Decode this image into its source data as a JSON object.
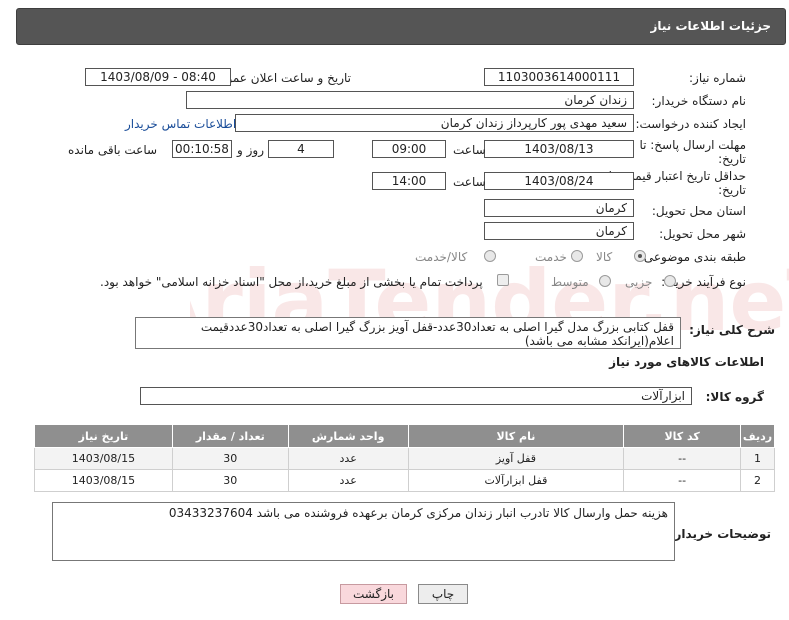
{
  "header": {
    "title": "جزئیات اطلاعات نیاز"
  },
  "labels": {
    "need_number": "شماره نیاز:",
    "announce_datetime": "تاریخ و ساعت اعلان عمومی:",
    "buyer_org": "نام دستگاه خریدار:",
    "requester": "ایجاد کننده درخواست:",
    "reply_deadline_1": "مهلت ارسال پاسخ: تا",
    "reply_deadline_2": "تاریخ:",
    "time": "ساعت",
    "day_and": "روز و",
    "time_remaining": "ساعت باقی مانده",
    "price_validity_1": "حداقل تاریخ اعتبار قیمت: تا",
    "price_validity_2": "تاریخ:",
    "delivery_province": "استان محل تحویل:",
    "delivery_city": "شهر محل تحویل:",
    "category": "طبقه بندی موضوعی:",
    "purchase_type": "نوع فرآیند خرید :",
    "need_desc": "شرح کلی نیاز:",
    "goods_info": "اطلاعات کالاهای مورد نیاز",
    "goods_group": "گروه کالا:",
    "buyer_notes": "توضیحات خریدار:"
  },
  "fields": {
    "need_number": "1103003614000111",
    "announce_datetime": "1403/08/09 - 08:40",
    "buyer_org": "زندان کرمان",
    "requester": "سعید مهدی پور کارپرداز زندان کرمان",
    "contact_link": "اطلاعات تماس خریدار",
    "reply_date": "1403/08/13",
    "reply_time": "09:00",
    "reply_days": "4",
    "remaining_time": "00:10:58",
    "validity_date": "1403/08/24",
    "validity_time": "14:00",
    "province": "کرمان",
    "city": "کرمان",
    "goods_group": "ابزارآلات"
  },
  "category_options": [
    {
      "label": "کالا",
      "selected": true
    },
    {
      "label": "خدمت",
      "selected": false
    },
    {
      "label": "کالا/خدمت",
      "selected": false
    }
  ],
  "purchase_options": [
    {
      "label": "جزیی",
      "selected": false
    },
    {
      "label": "متوسط",
      "selected": false
    }
  ],
  "payment_note": "پرداخت تمام یا بخشی از مبلغ خرید،از محل \"اسناد خزانه اسلامی\" خواهد بود.",
  "need_description": "قفل کتابی بزرگ مدل گیرا اصلی به تعداد30عدد-قفل آویز بزرگ گیرا اصلی به تعداد30عددقیمت اعلام(ایرانکد مشابه می باشد)",
  "table": {
    "headers": [
      "ردیف",
      "کد کالا",
      "نام کالا",
      "واحد شمارش",
      "تعداد / مقدار",
      "تاریخ نیاز"
    ],
    "rows": [
      [
        "1",
        "--",
        "قفل آویز",
        "عدد",
        "30",
        "1403/08/15"
      ],
      [
        "2",
        "--",
        "قفل ابزارآلات",
        "عدد",
        "30",
        "1403/08/15"
      ]
    ]
  },
  "buyer_notes": "هزینه حمل وارسال کالا تادرب انبار زندان مرکزی کرمان برعهده فروشنده می باشد 03433237604",
  "buttons": {
    "print": "چاپ",
    "back": "بازگشت"
  },
  "watermark_text": "AriaTender.neT",
  "colors": {
    "header_bg": "#555555",
    "link": "#1a4d99",
    "table_header": "#8f8f8f",
    "back_button": "#f9d8dc"
  }
}
